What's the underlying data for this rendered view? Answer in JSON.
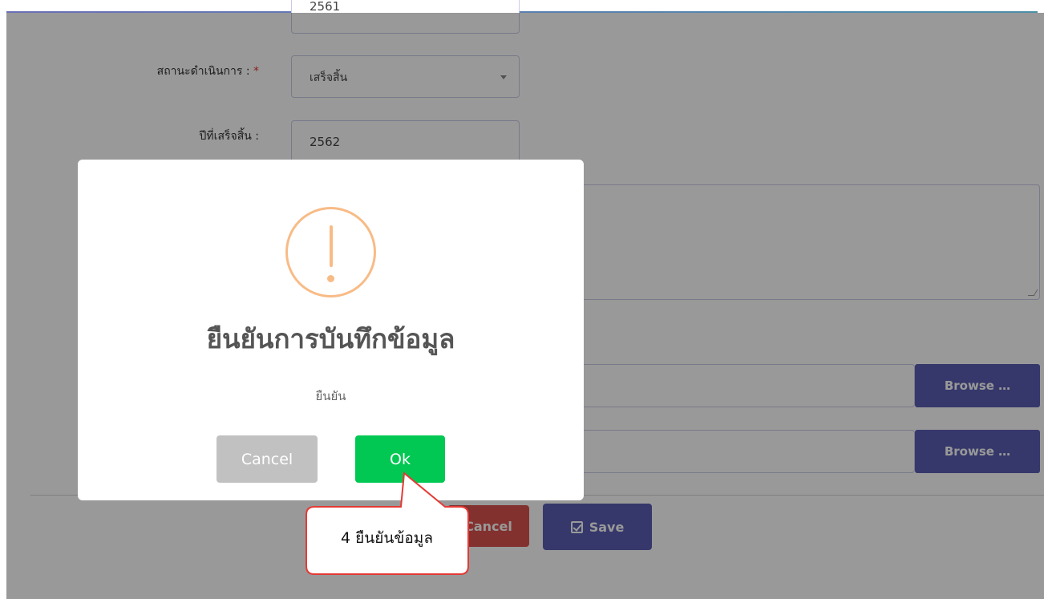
{
  "form": {
    "start_year_value": "2561",
    "status_label": "สถานะดำเนินการ :",
    "required_mark": "*",
    "status_value": "เสร็จสิ้น",
    "finish_year_label": "ปีที่เสร็จสิ้น :",
    "finish_year_value": "2562",
    "browse_label_1": "Browse …",
    "browse_label_2": "Browse …",
    "cancel_label": "Cancel",
    "save_label": "Save"
  },
  "dialog": {
    "icon": "warning-icon",
    "title": "ยืนยันการบันทึกข้อมูล",
    "text": "ยืนยัน",
    "cancel_label": "Cancel",
    "ok_label": "Ok"
  },
  "callout": {
    "text": "4 ยืนยันข้อมูล",
    "border_color": "#e53935"
  },
  "colors": {
    "ok_button": "#00c853",
    "cancel_button": "#c1c1c1",
    "primary_button": "#5b5eb3",
    "danger_button": "#d9534f",
    "warning_icon": "#f8bb86",
    "overlay": "rgba(0,0,0,0.4)"
  }
}
